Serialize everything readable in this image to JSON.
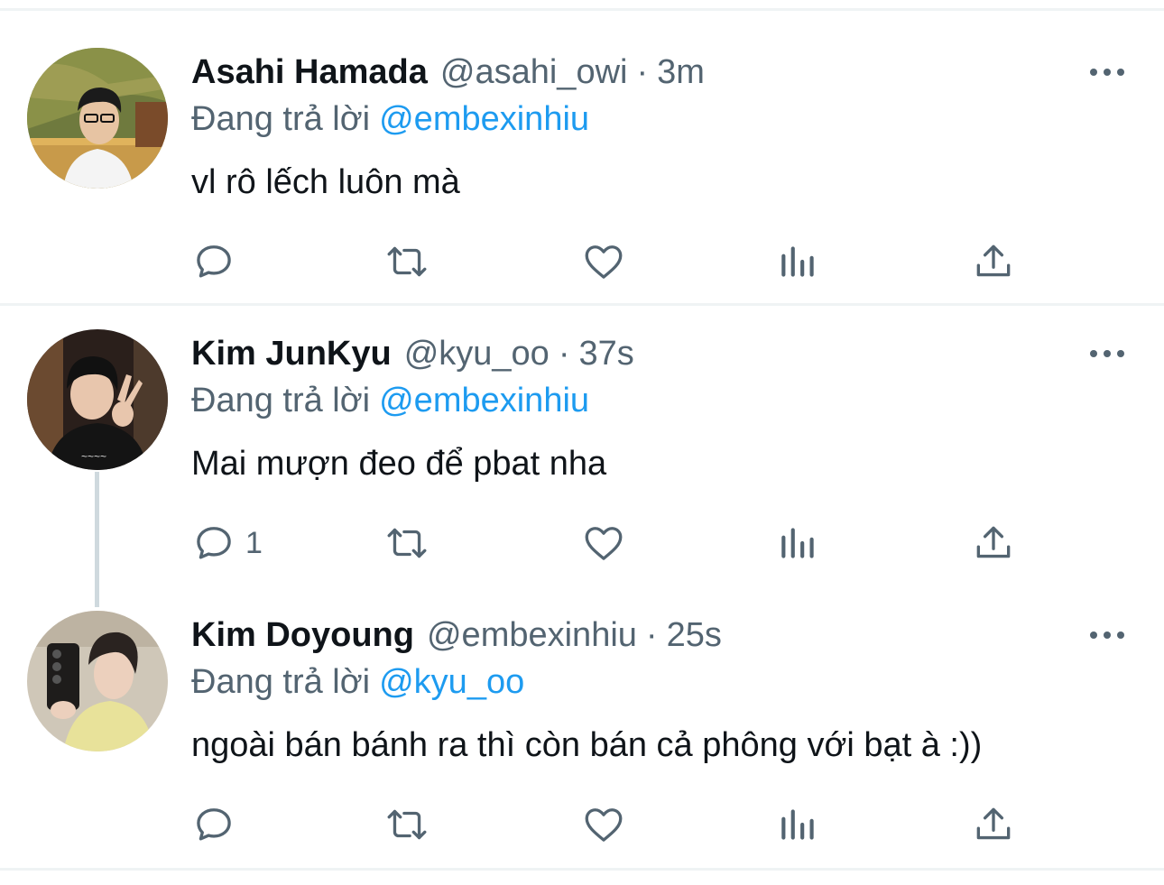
{
  "tweets": [
    {
      "name": "Asahi Hamada",
      "handle": "@asahi_owi",
      "separator": "·",
      "time": "3m",
      "replying_prefix": "Đang trả lời",
      "replying_to": "@embexinhiu",
      "text": "vl rô lếch luôn mà",
      "reply_count": ""
    },
    {
      "name": "Kim JunKyu",
      "handle": "@kyu_oo",
      "separator": "·",
      "time": "37s",
      "replying_prefix": "Đang trả lời",
      "replying_to": "@embexinhiu",
      "text": "Mai mượn đeo để pbat nha",
      "reply_count": "1"
    },
    {
      "name": "Kim Doyoung",
      "handle": "@embexinhiu",
      "separator": "·",
      "time": "25s",
      "replying_prefix": "Đang trả lời",
      "replying_to": "@kyu_oo",
      "text": "ngoài bán bánh ra thì còn bán cả phông với bạt à :))",
      "reply_count": ""
    }
  ],
  "icons": {
    "reply": "reply-bubble-icon",
    "retweet": "retweet-icon",
    "like": "heart-icon",
    "views": "analytics-bars-icon",
    "share": "share-upload-icon",
    "more": "more-dots-icon"
  },
  "colors": {
    "text_primary": "#0f1419",
    "text_secondary": "#536471",
    "link": "#1d9bf0",
    "divider": "#eff3f4",
    "thread_line": "#cfd9de"
  }
}
